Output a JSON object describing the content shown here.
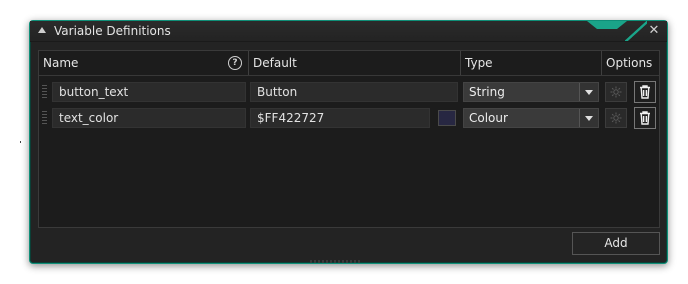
{
  "window": {
    "title": "Variable Definitions",
    "accent_color": "#1aa489",
    "close_icon": "close-icon"
  },
  "table": {
    "columns": [
      "Name",
      "Default",
      "Type",
      "Options"
    ],
    "help_icon": "question-circle-icon",
    "rows": [
      {
        "name": "button_text",
        "default": "Button",
        "type": "String",
        "swatch": null
      },
      {
        "name": "text_color",
        "default": "$FF422727",
        "type": "Colour",
        "swatch": "#272742"
      }
    ]
  },
  "footer": {
    "add_label": "Add"
  }
}
